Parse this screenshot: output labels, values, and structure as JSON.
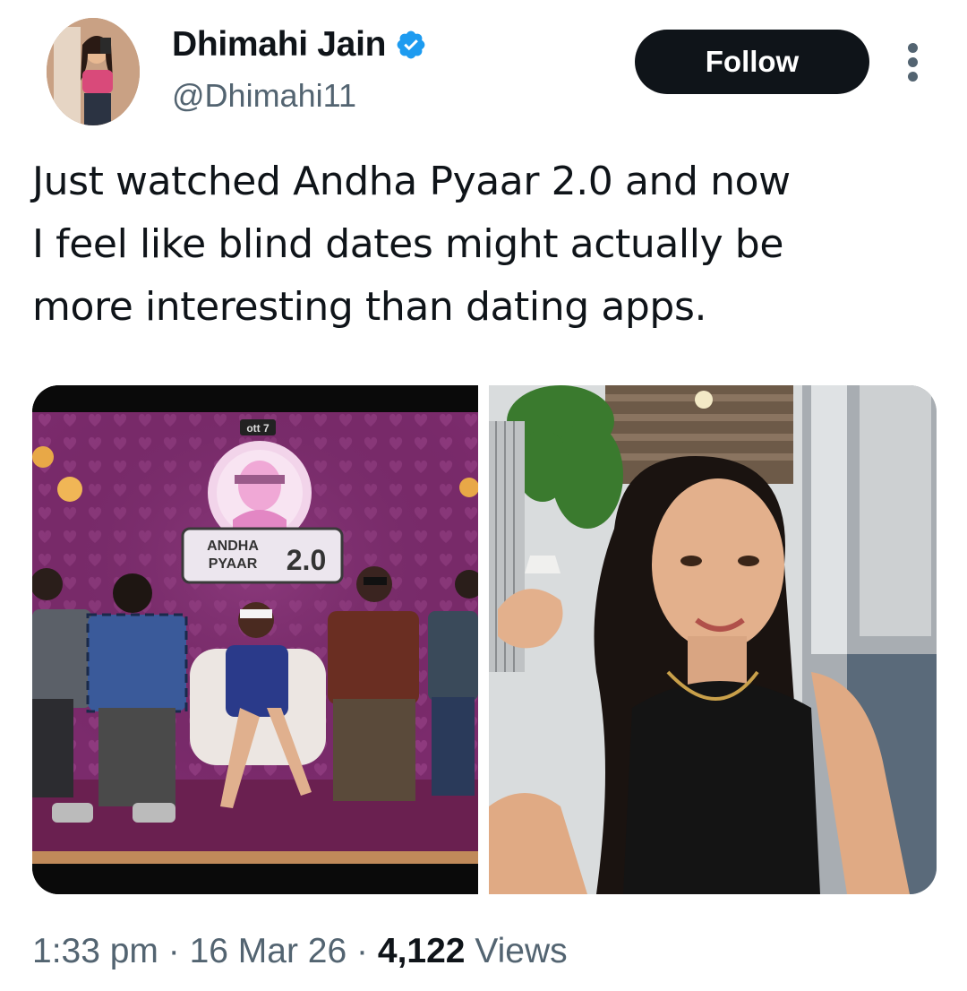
{
  "author": {
    "display_name": "Dhimahi Jain",
    "handle": "@Dhimahi11",
    "verified_icon": "verified-badge-icon",
    "avatar_icon": "profile-avatar"
  },
  "actions": {
    "follow_label": "Follow",
    "more_icon": "more-vertical-icon"
  },
  "tweet": {
    "text_lines": [
      "Just watched Andha Pyaar 2.0 and now",
      "I feel like blind dates might actually be",
      "more interesting than dating apps."
    ]
  },
  "media": {
    "left_image": {
      "channel_logo": "ott 7",
      "show_title_line1": "ANDHA",
      "show_title_line2": "PYAAR",
      "show_title_version": "2.0"
    },
    "right_image": {
      "subject": "selfie"
    }
  },
  "footer": {
    "time": "1:33 pm",
    "sep1": " · ",
    "date": "16 Mar 26",
    "sep2": " · ",
    "views_count": "4,122",
    "views_label": " Views"
  },
  "colors": {
    "accent_verified": "#1d9bf0",
    "follow_bg": "#0f1419",
    "secondary_text": "#536471",
    "stage_purple": "#7a2a6a"
  }
}
